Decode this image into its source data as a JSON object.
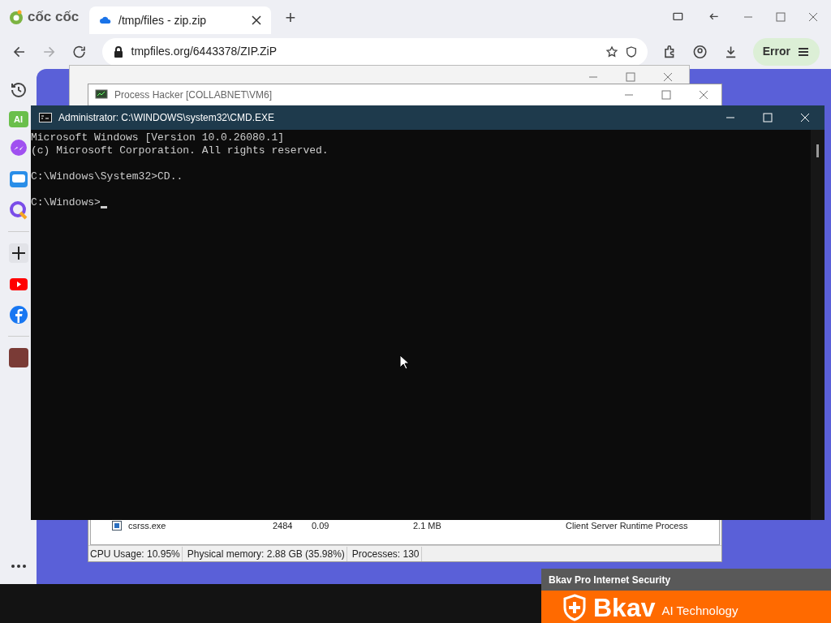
{
  "browser": {
    "brand": "cốc cốc",
    "tabs": [
      {
        "title": "/tmp/files - zip.zip",
        "selected": true
      }
    ],
    "new_tab": "+",
    "address": "tmpfiles.org/6443378/ZIP.ZiP",
    "error_button": "Error"
  },
  "process_hacker": {
    "title": "Process Hacker [COLLABNET\\VM6]",
    "rows": [
      {
        "name": "csrss.exe",
        "pid": "2484",
        "cpu": "0.09",
        "memory": "2.1 MB",
        "description": "Client Server Runtime Process"
      }
    ],
    "status": [
      "CPU Usage: 10.95%",
      "Physical memory: 2.88 GB (35.98%)",
      "Processes: 130"
    ]
  },
  "cmd": {
    "title": "Administrator: C:\\WINDOWS\\system32\\CMD.EXE",
    "blocks": [
      [
        "Microsoft Windows [Version 10.0.26080.1]",
        "(c) Microsoft Corporation. All rights reserved."
      ],
      [
        "C:\\Windows\\System32>CD.."
      ],
      [
        "C:\\Windows>"
      ]
    ]
  },
  "sidebar": {
    "ai_label": "AI"
  },
  "bkav": {
    "title": "Bkav Pro Internet Security",
    "brand": "Bkav",
    "tagline": "AI Technology"
  }
}
